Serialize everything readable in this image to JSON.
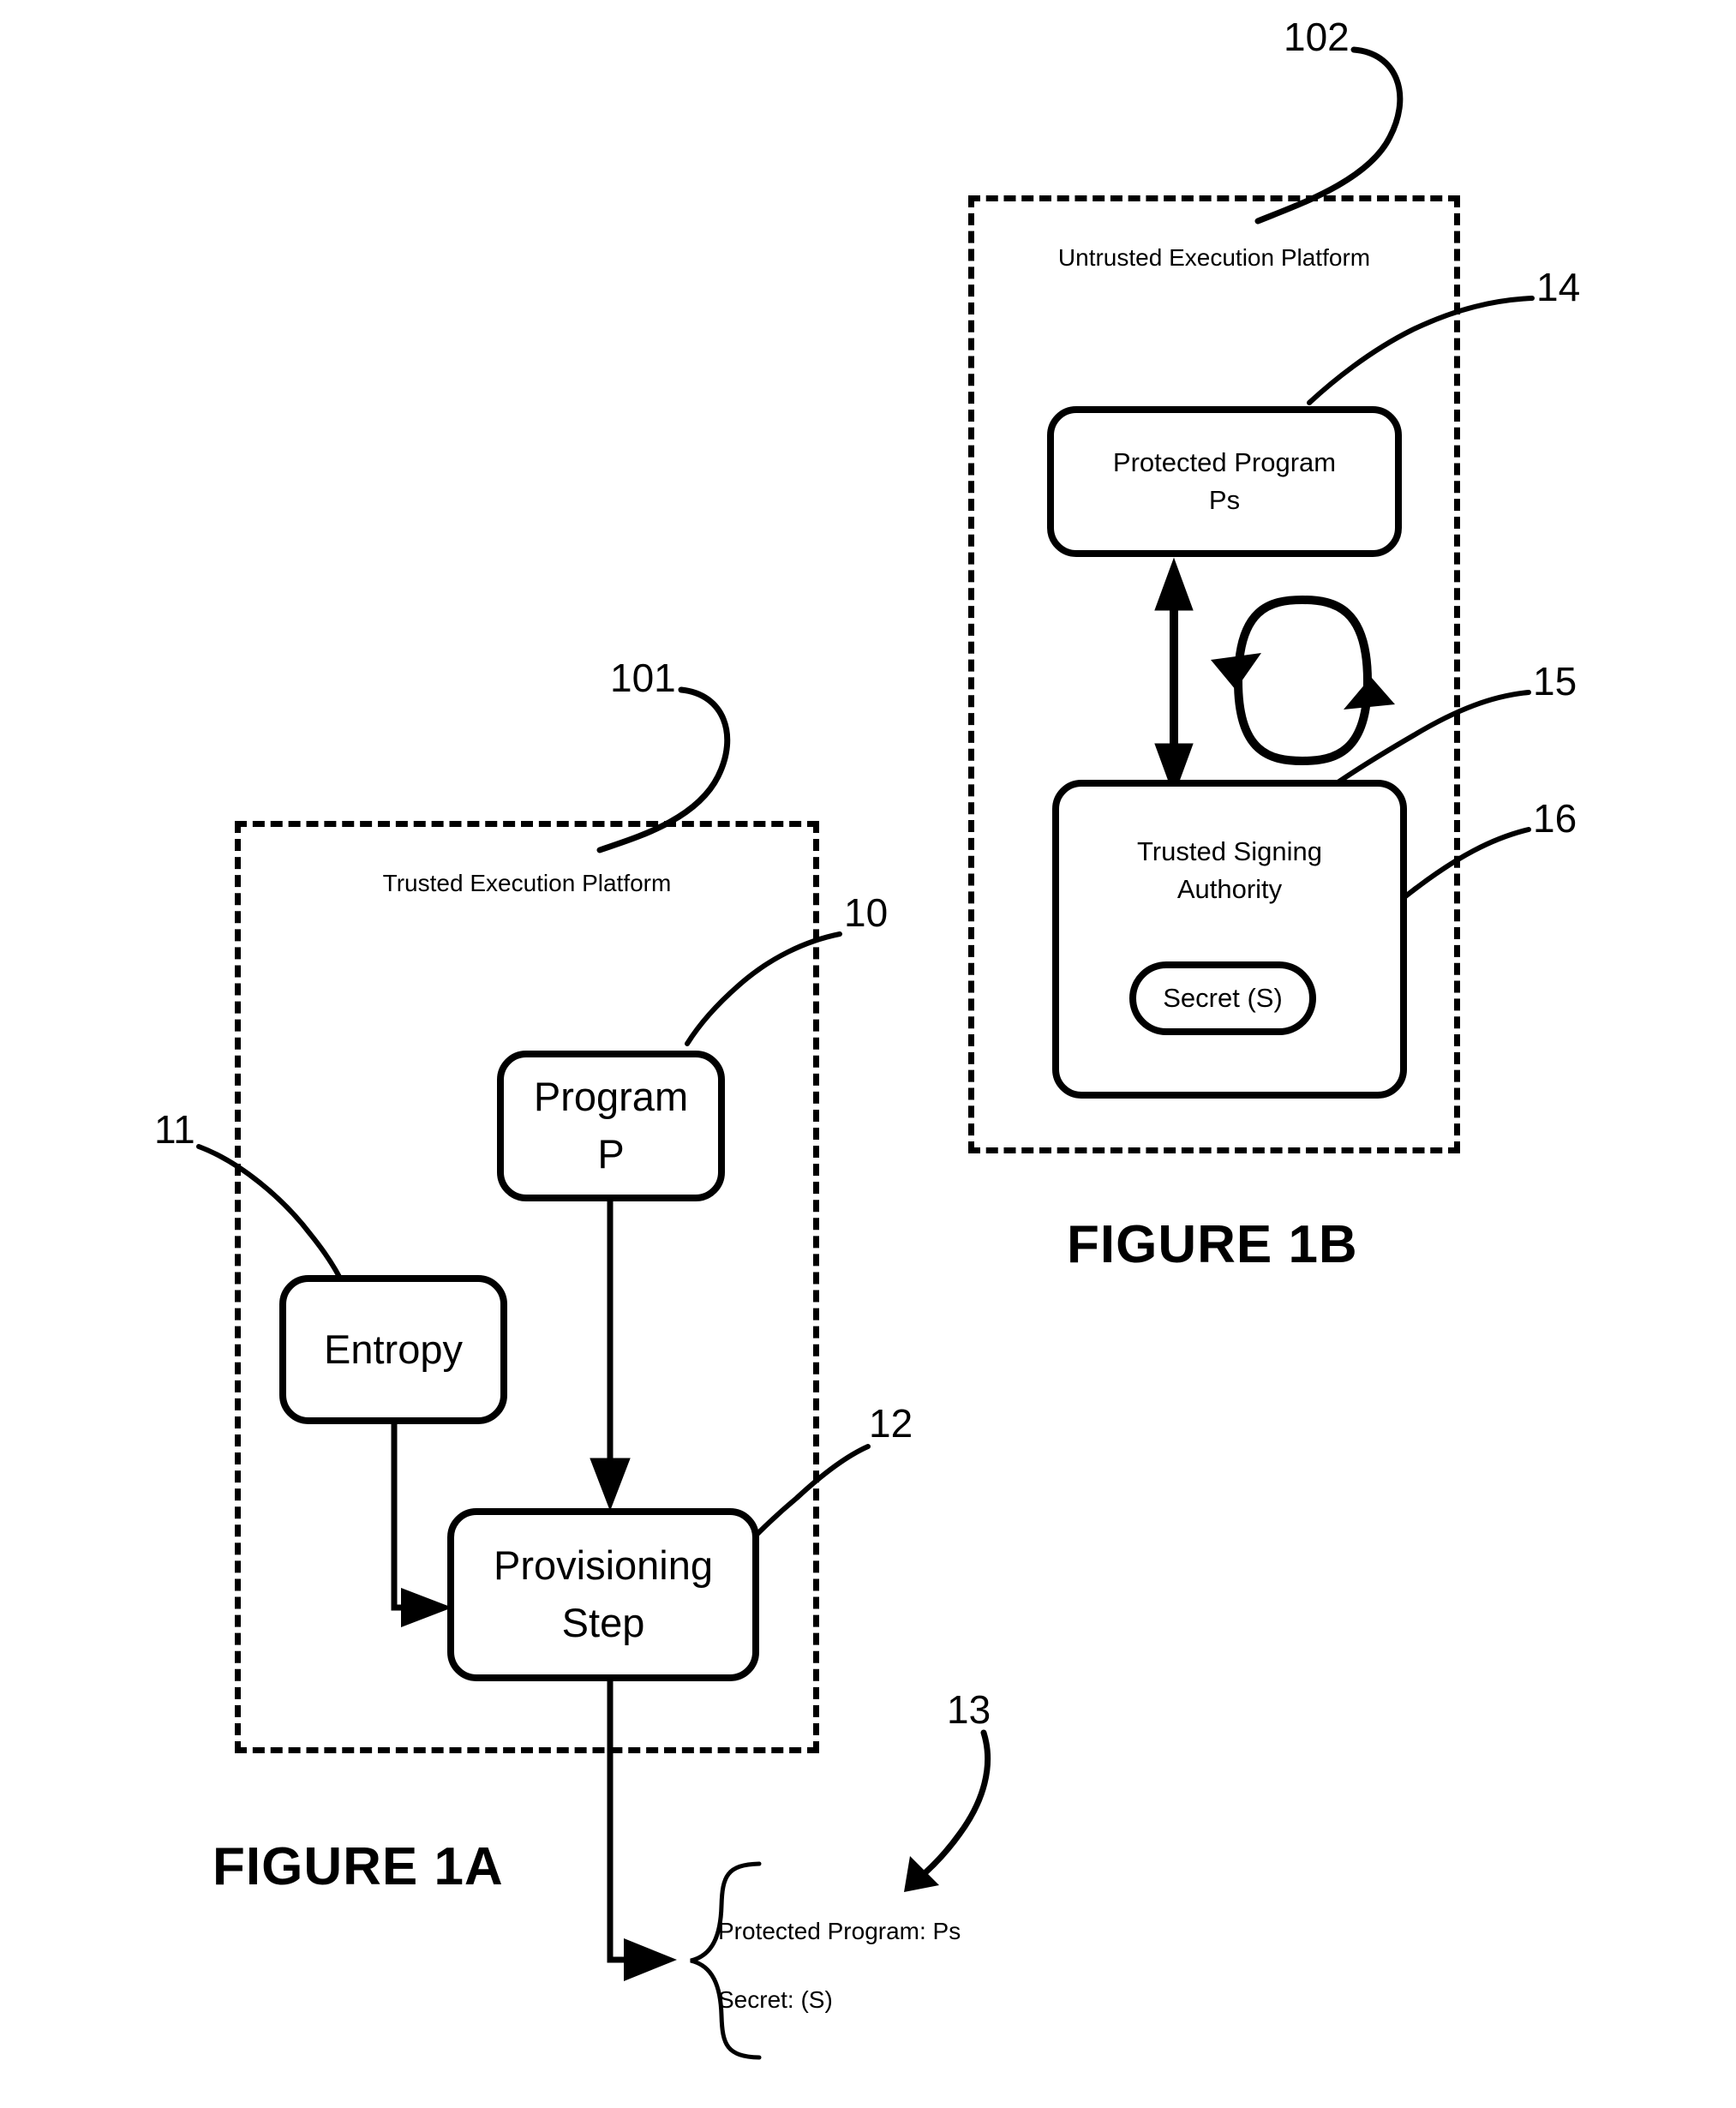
{
  "figures": [
    {
      "id": "figure-1a",
      "caption": "FIGURE 1A",
      "platform_ref": "101",
      "platform_label_line1": "Trusted",
      "platform_label_line2": "Execution Platform",
      "nodes": [
        {
          "ref": "10",
          "line1": "Program",
          "line2": "P"
        },
        {
          "ref": "11",
          "line1": "Entropy",
          "line2": ""
        },
        {
          "ref": "12",
          "line1": "Provisioning",
          "line2": "Step"
        }
      ],
      "output": {
        "ref": "13",
        "line1": "Protected Program: Ps",
        "line2": "Secret: (S)"
      }
    },
    {
      "id": "figure-1b",
      "caption": "FIGURE 1B",
      "platform_ref": "102",
      "platform_label_line1": "Untrusted",
      "platform_label_line2": "Execution Platform",
      "nodes": [
        {
          "ref": "14",
          "line1": "Protected Program",
          "line2": "Ps"
        },
        {
          "ref": "15",
          "line1": "Trusted Signing",
          "line2": "Authority"
        },
        {
          "ref": "16",
          "line1": "Secret (S)",
          "line2": ""
        }
      ]
    }
  ],
  "style": {
    "ink": "#000000",
    "paper": "#ffffff"
  }
}
